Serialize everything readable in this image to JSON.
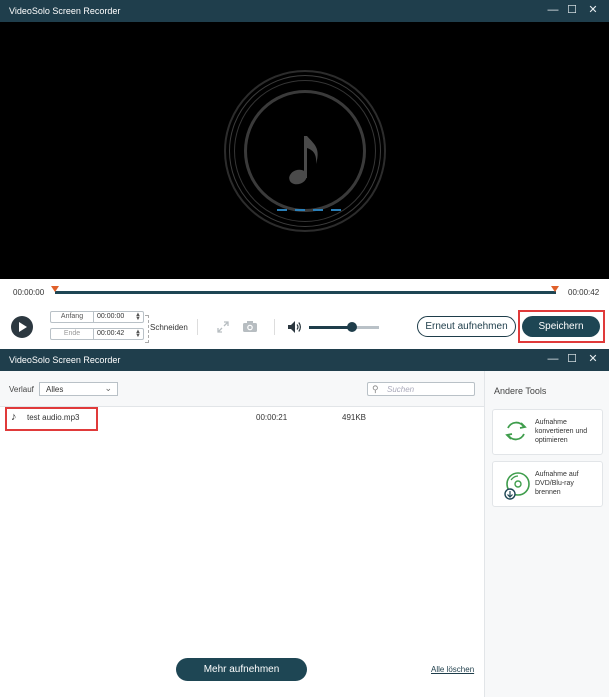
{
  "window1": {
    "title": "VideoSolo Screen Recorder",
    "controls": {
      "minimize": "—",
      "maximize": "☐",
      "close": "✕"
    },
    "preview_icon": "music-note-icon",
    "timeline": {
      "start": "00:00:00",
      "end": "00:00:42"
    },
    "trim": {
      "start_label": "Anfang",
      "start_value": "00:00:00",
      "end_label": "Ende",
      "end_value": "00:00:42",
      "cut_label": "Schneiden"
    },
    "volume_level_percent": 62,
    "buttons": {
      "rerecord": "Erneut aufnehmen",
      "save": "Speichern"
    },
    "colors": {
      "accent": "#1e4654",
      "marker": "#e0602a",
      "highlight": "#e03a3a"
    }
  },
  "window2": {
    "title": "VideoSolo Screen Recorder",
    "controls": {
      "minimize": "—",
      "maximize": "☐",
      "close": "✕"
    },
    "filter": {
      "label": "Verlauf",
      "selected": "Alles"
    },
    "search": {
      "placeholder": "Suchen"
    },
    "files": [
      {
        "icon": "music-note-icon",
        "name": "test audio.mp3",
        "duration": "00:00:21",
        "size": "491KB"
      }
    ],
    "buttons": {
      "record_more": "Mehr aufnehmen",
      "delete_all": "Alle löschen"
    },
    "tools": {
      "title": "Andere Tools",
      "items": [
        {
          "icon": "convert-icon",
          "label_lines": [
            "Aufnahme",
            "konvertieren und",
            "optimieren"
          ]
        },
        {
          "icon": "disc-burn-icon",
          "label_lines": [
            "Aufnahme auf",
            "DVD/Blu-ray",
            "brennen"
          ]
        }
      ]
    }
  }
}
